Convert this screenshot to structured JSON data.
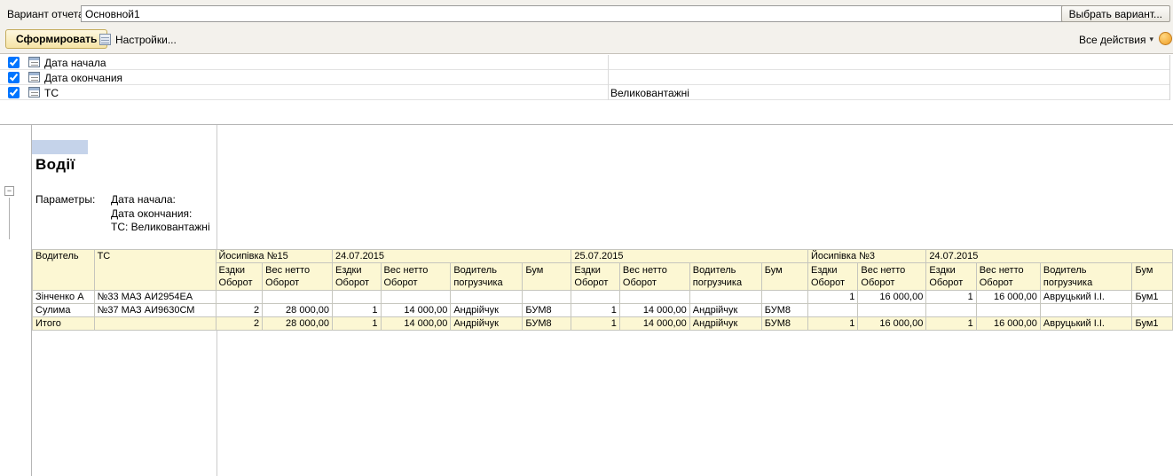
{
  "topbar": {
    "variant_label": "Вариант отчета:",
    "variant_value": "Основной1",
    "choose_variant_button": "Выбрать вариант..."
  },
  "toolbar": {
    "generate": "Сформировать",
    "settings": "Настройки...",
    "all_actions": "Все действия"
  },
  "filters": [
    {
      "checked": true,
      "label": "Дата начала",
      "value": ""
    },
    {
      "checked": true,
      "label": "Дата окончания",
      "value": ""
    },
    {
      "checked": true,
      "label": "ТС",
      "value": "Великовантажні"
    }
  ],
  "report": {
    "title": "Водії",
    "params_label": "Параметры:",
    "param_lines": [
      "Дата начала:",
      "Дата окончания:",
      "ТС: Великовантажні"
    ]
  },
  "report_table": {
    "col_driver": "Водитель",
    "col_vehicle": "ТС",
    "groups": [
      {
        "label": "Йосипівка №15"
      },
      {
        "label": "24.07.2015"
      },
      {
        "label": "25.07.2015"
      },
      {
        "label": "Йосипівка №3"
      },
      {
        "label": "24.07.2015"
      }
    ],
    "subheaders": [
      "Ездки Оборот",
      "Вес нетто Оборот",
      "Ездки Оборот",
      "Вес нетто Оборот",
      "Водитель погрузчика",
      "Бум",
      "Ездки Оборот",
      "Вес нетто Оборот",
      "Водитель погрузчика",
      "Бум",
      "Ездки Оборот",
      "Вес нетто Оборот",
      "Ездки Оборот",
      "Вес нетто Оборот",
      "Водитель погрузчика",
      "Бум"
    ],
    "rows": [
      {
        "cells": [
          "Зінченко А",
          "№33 МАЗ АИ2954ЕА",
          "",
          "",
          "",
          "",
          "",
          "",
          "",
          "",
          "",
          "",
          "1",
          "16 000,00",
          "1",
          "16 000,00",
          "Авруцький І.І.",
          "Бум1"
        ]
      },
      {
        "cells": [
          "Сулима",
          "№37 МАЗ АИ9630СМ",
          "2",
          "28 000,00",
          "1",
          "14 000,00",
          "Андрійчук",
          "БУМ8",
          "1",
          "14 000,00",
          "Андрійчук",
          "БУМ8",
          "",
          "",
          "",
          "",
          "",
          ""
        ]
      },
      {
        "cells": [
          "Итого",
          "",
          "2",
          "28 000,00",
          "1",
          "14 000,00",
          "Андрійчук",
          "БУМ8",
          "1",
          "14 000,00",
          "Андрійчук",
          "БУМ8",
          "1",
          "16 000,00",
          "1",
          "16 000,00",
          "Авруцький І.І.",
          "Бум1"
        ]
      }
    ]
  },
  "colors": {
    "header_bg": "#fcf7d3",
    "selection": "#c5d3ea",
    "generate_button_bg": "#f6e4a6"
  }
}
